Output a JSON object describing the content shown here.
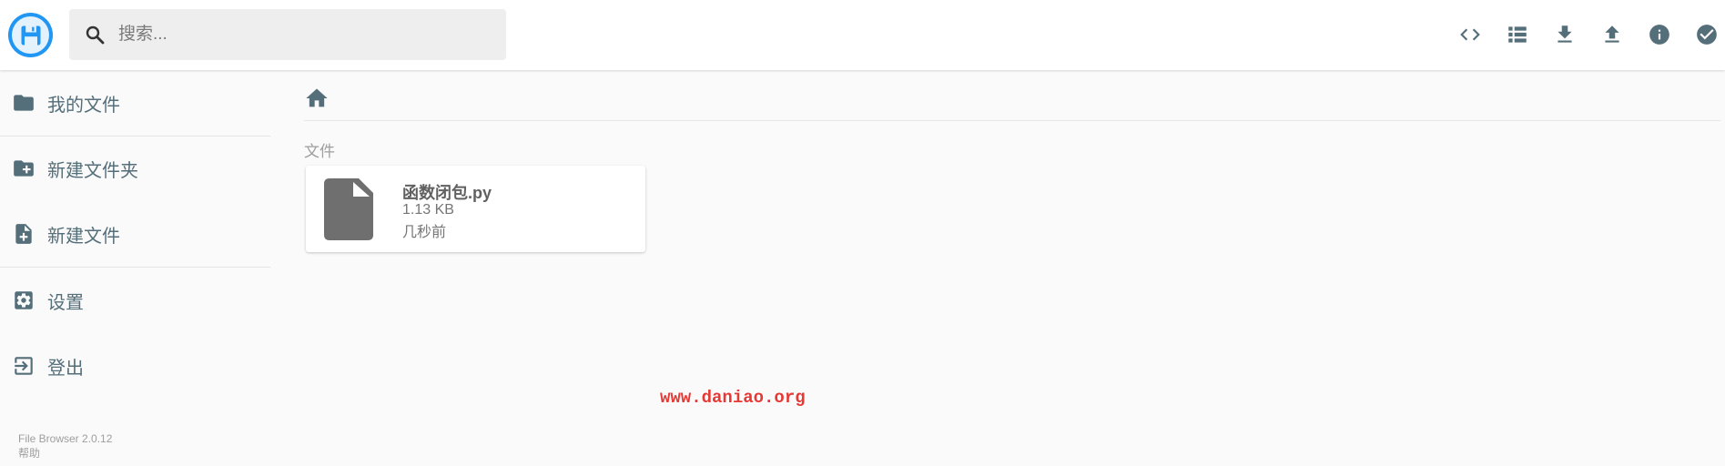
{
  "header": {
    "search_placeholder": "搜索...",
    "actions": [
      "code-icon",
      "list-view-icon",
      "download-icon",
      "upload-icon",
      "info-icon",
      "select-check-icon"
    ]
  },
  "sidebar": {
    "items": [
      {
        "label": "我的文件",
        "icon": "folder-icon"
      },
      {
        "label": "新建文件夹",
        "icon": "new-folder-icon"
      },
      {
        "label": "新建文件",
        "icon": "new-file-icon"
      },
      {
        "label": "设置",
        "icon": "settings-icon"
      },
      {
        "label": "登出",
        "icon": "logout-icon"
      }
    ],
    "credits": {
      "version": "File Browser 2.0.12",
      "help": "帮助"
    }
  },
  "main": {
    "section_title": "文件",
    "files": [
      {
        "name": "函数闭包.py",
        "size": "1.13 KB",
        "modified": "几秒前",
        "icon": "file-icon"
      }
    ]
  },
  "watermark": "www.daniao.org",
  "colors": {
    "accent": "#2196f3",
    "icon": "#546e7a",
    "watermark": "#e53935"
  }
}
